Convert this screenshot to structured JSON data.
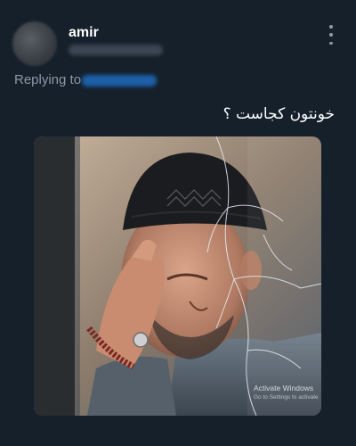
{
  "tweet": {
    "author_name": "amir",
    "replying_label": "Replying to",
    "text": "خونتون کجاست ؟",
    "more_icon": "more-vertical-icon"
  },
  "media": {
    "watermark_title": "Activate Windows",
    "watermark_subtitle": "Go to Settings to activate"
  }
}
